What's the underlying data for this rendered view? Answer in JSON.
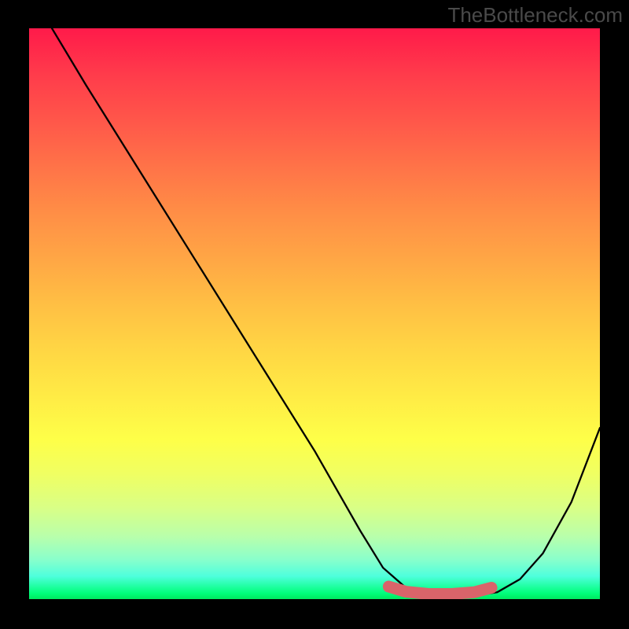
{
  "watermark": "TheBottleneck.com",
  "chart_data": {
    "type": "line",
    "title": "",
    "xlabel": "",
    "ylabel": "",
    "xlim": [
      0,
      100
    ],
    "ylim": [
      0,
      100
    ],
    "grid": false,
    "series": [
      {
        "name": "bottleneck-curve",
        "x": [
          4,
          10,
          20,
          30,
          40,
          50,
          58,
          62,
          66,
          70,
          74,
          78,
          82,
          86,
          90,
          95,
          100
        ],
        "values": [
          100,
          90,
          74,
          58,
          42,
          26,
          12,
          5.5,
          2,
          0.8,
          0.5,
          0.6,
          1.2,
          3.5,
          8,
          17,
          30
        ],
        "color": "#000000"
      },
      {
        "name": "sweet-spot-marker",
        "x": [
          63,
          66,
          70,
          74,
          78,
          81
        ],
        "values": [
          2.2,
          1.3,
          0.9,
          0.9,
          1.2,
          2.0
        ],
        "color": "#d9646a"
      }
    ],
    "annotations": [],
    "gradient_stops": [
      {
        "pos": 0,
        "color": "#ff1a4a"
      },
      {
        "pos": 50,
        "color": "#ffd544"
      },
      {
        "pos": 80,
        "color": "#f0ff62"
      },
      {
        "pos": 100,
        "color": "#00e85f"
      }
    ]
  }
}
